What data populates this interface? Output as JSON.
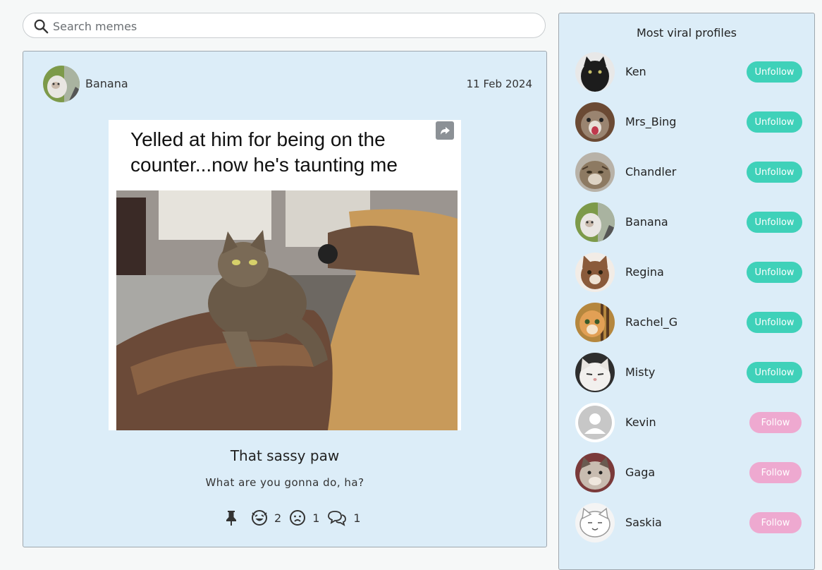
{
  "search": {
    "placeholder": "Search memes"
  },
  "post": {
    "author": "Banana",
    "date": "11 Feb 2024",
    "meme_caption": "Yelled at him for being on the counter...now he's taunting me",
    "title": "That sassy paw",
    "subtitle": "What are you gonna do, ha?",
    "reactions": {
      "laugh_count": "2",
      "sad_count": "1",
      "comment_count": "1"
    }
  },
  "sidebar": {
    "title": "Most viral profiles",
    "profiles": [
      {
        "name": "Ken",
        "button": "Unfollow"
      },
      {
        "name": "Mrs_Bing",
        "button": "Unfollow"
      },
      {
        "name": "Chandler",
        "button": "Unfollow"
      },
      {
        "name": "Banana",
        "button": "Unfollow"
      },
      {
        "name": "Regina",
        "button": "Unfollow"
      },
      {
        "name": "Rachel_G",
        "button": "Unfollow"
      },
      {
        "name": "Misty",
        "button": "Unfollow"
      },
      {
        "name": "Kevin",
        "button": "Follow"
      },
      {
        "name": "Gaga",
        "button": "Follow"
      },
      {
        "name": "Saskia",
        "button": "Follow"
      }
    ]
  },
  "colors": {
    "card_bg": "#dcedf8",
    "unfollow": "#3fd1b9",
    "follow": "#eea9d0"
  }
}
